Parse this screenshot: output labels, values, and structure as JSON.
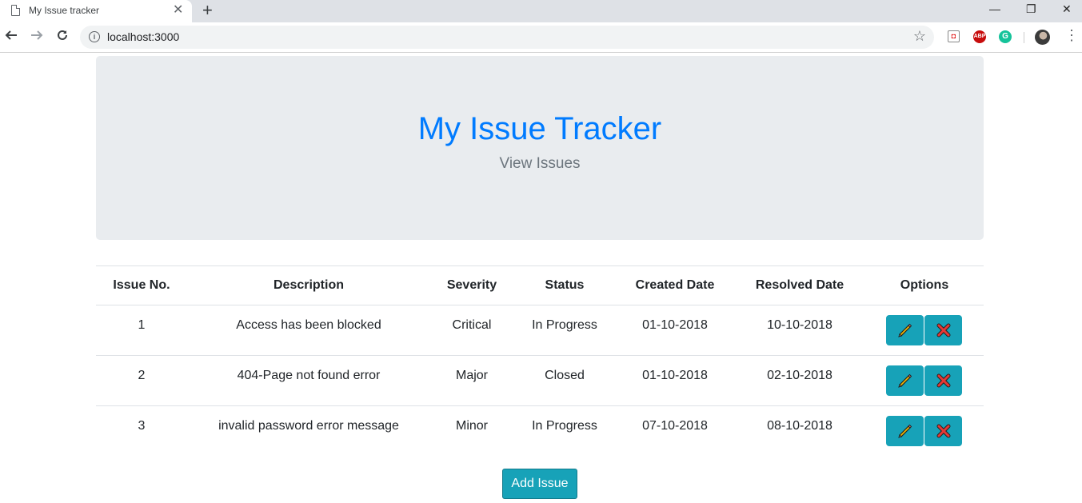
{
  "browser": {
    "tab_title": "My Issue tracker",
    "new_tab": "+",
    "tab_close": "✕",
    "url": "localhost:3000",
    "win_minimize": "—",
    "win_restore": "❐",
    "win_close": "✕",
    "ext_pocket": "◘",
    "ext_abp": "ABP",
    "ext_grammarly": "G"
  },
  "header": {
    "title": "My Issue Tracker",
    "subtitle": "View Issues"
  },
  "table": {
    "columns": [
      "Issue No.",
      "Description",
      "Severity",
      "Status",
      "Created Date",
      "Resolved Date",
      "Options"
    ],
    "rows": [
      {
        "no": "1",
        "description": "Access has been blocked",
        "severity": "Critical",
        "status": "In Progress",
        "created": "01-10-2018",
        "resolved": "10-10-2018"
      },
      {
        "no": "2",
        "description": "404-Page not found error",
        "severity": "Major",
        "status": "Closed",
        "created": "01-10-2018",
        "resolved": "02-10-2018"
      },
      {
        "no": "3",
        "description": "invalid password error message",
        "severity": "Minor",
        "status": "In Progress",
        "created": "07-10-2018",
        "resolved": "08-10-2018"
      }
    ]
  },
  "actions": {
    "add_label": "Add Issue"
  },
  "colors": {
    "accent": "#007bff",
    "info": "#17a2b8",
    "jumbotron": "#e9ecef"
  }
}
